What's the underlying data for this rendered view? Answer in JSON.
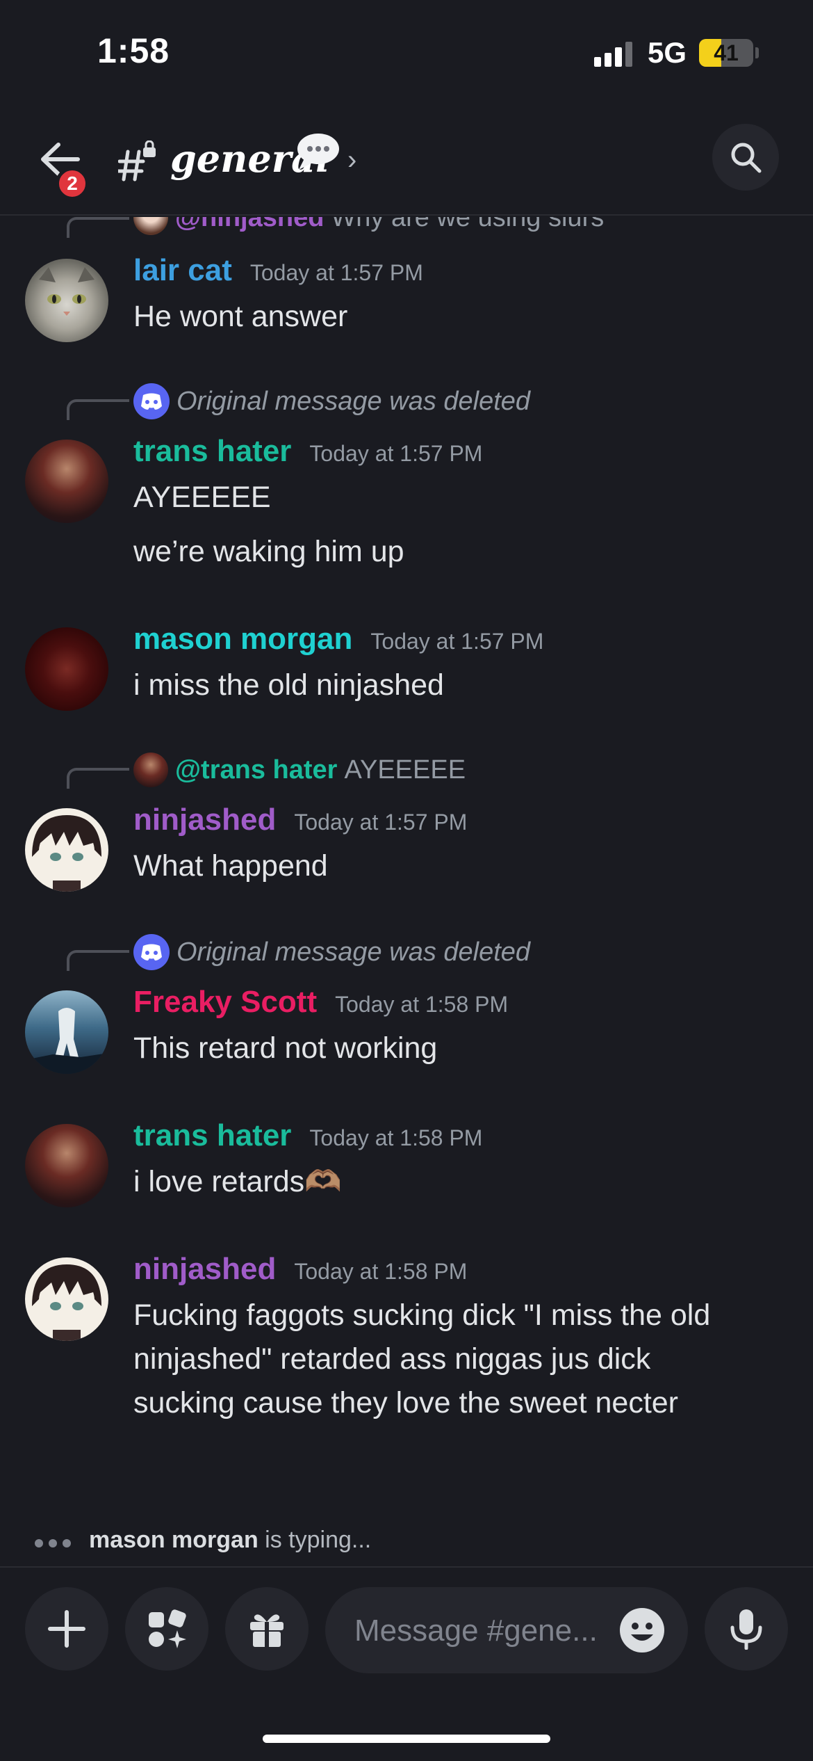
{
  "status_bar": {
    "time": "1:58",
    "network": "5G",
    "battery": "41",
    "battery_fraction": 0.41
  },
  "header": {
    "back_badge": "2",
    "channel_name": "general"
  },
  "messages": [
    {
      "reply": {
        "mention": "@ninjashed",
        "text": "Why are we using slurs"
      },
      "author": "lair cat",
      "timestamp": "Today at 1:57 PM",
      "lines": [
        "He wont answer"
      ]
    },
    {
      "reply": {
        "deleted": "Original message was deleted"
      },
      "author": "trans hater",
      "timestamp": "Today at 1:57 PM",
      "lines": [
        "AYEEEEE",
        "we’re waking him up"
      ]
    },
    {
      "author": "mason morgan",
      "timestamp": "Today at 1:57 PM",
      "lines": [
        "i miss the old ninjashed"
      ]
    },
    {
      "reply": {
        "mention": "@trans hater",
        "text": "AYEEEEE"
      },
      "author": "ninjashed",
      "timestamp": "Today at 1:57 PM",
      "lines": [
        "What happend"
      ]
    },
    {
      "reply": {
        "deleted": "Original message was deleted"
      },
      "author": "Freaky Scott",
      "timestamp": "Today at 1:58 PM",
      "lines": [
        "This retard not working"
      ]
    },
    {
      "author": "trans hater",
      "timestamp": "Today at 1:58 PM",
      "lines": [
        "i love retards🫶🏽"
      ]
    },
    {
      "author": "ninjashed",
      "timestamp": "Today at 1:58 PM",
      "lines": [
        "Fucking faggots sucking dick \"I miss the old",
        "ninjashed\" retarded ass niggas jus dick",
        "sucking cause they love the sweet necter"
      ]
    }
  ],
  "typing": {
    "user": "mason morgan",
    "text": "is typing..."
  },
  "composer": {
    "placeholder": "Message #gene..."
  },
  "colors": {
    "background": "#1a1b21",
    "lair_cat": "#3d9fe0",
    "trans_hater": "#1abc9c",
    "mason_morgan": "#1fd1d1",
    "ninjashed": "#a05cc9",
    "freaky_scott": "#e91e63",
    "discord_blurple": "#5865f2"
  },
  "icons": [
    "back-arrow-icon",
    "text-channel-icon",
    "speech-bubble-emoji",
    "chevron-right-icon",
    "search-icon",
    "discord-logo-icon",
    "plus-icon",
    "apps-icon",
    "gift-icon",
    "emoji-icon",
    "microphone-icon"
  ]
}
